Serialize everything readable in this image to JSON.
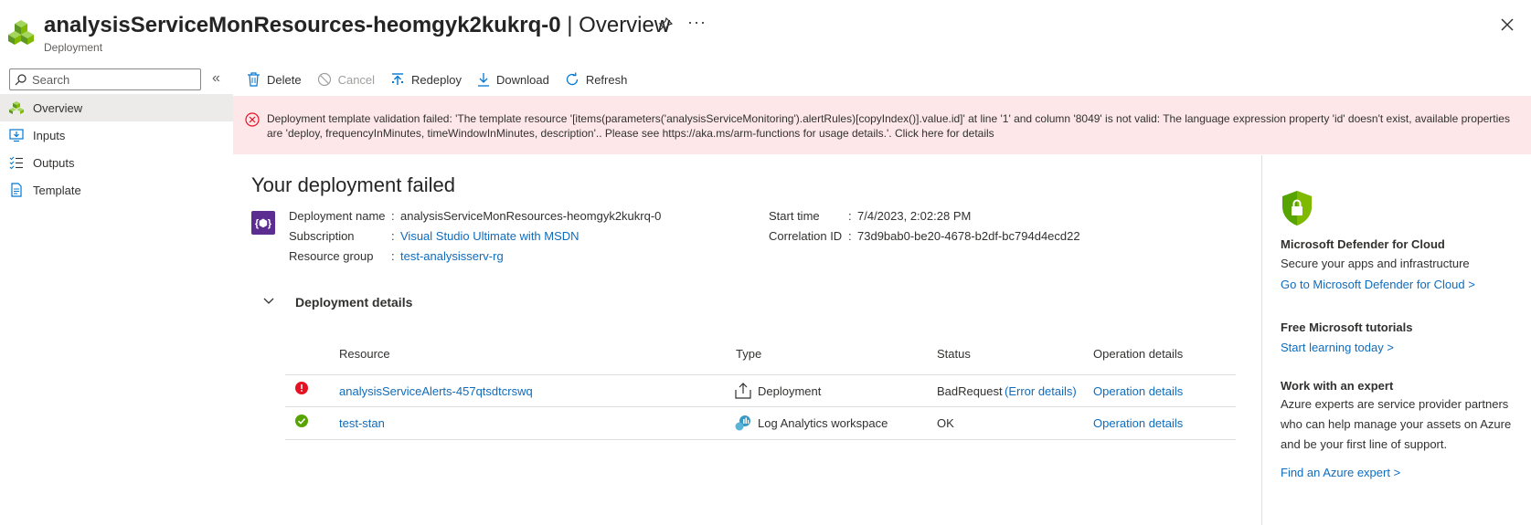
{
  "header": {
    "resource_name": "analysisServiceMonResources-heomgyk2kukrq-0",
    "separator": " | ",
    "page": "Overview",
    "subtitle": "Deployment",
    "more": "···"
  },
  "sidebar": {
    "search_placeholder": "Search",
    "collapse": "«",
    "items": [
      {
        "label": "Overview",
        "icon": "overview-cubes-icon",
        "active": true
      },
      {
        "label": "Inputs",
        "icon": "inputs-icon"
      },
      {
        "label": "Outputs",
        "icon": "outputs-icon"
      },
      {
        "label": "Template",
        "icon": "template-icon"
      }
    ]
  },
  "toolbar": {
    "delete": "Delete",
    "cancel": "Cancel",
    "redeploy": "Redeploy",
    "download": "Download",
    "refresh": "Refresh"
  },
  "banner": {
    "message": "Deployment template validation failed: 'The template resource '[items(parameters('analysisServiceMonitoring').alertRules)[copyIndex()].value.id]' at line '1' and column '8049' is not valid: The language expression property 'id' doesn't exist, available properties are 'deploy, frequencyInMinutes, timeWindowInMinutes, description'.. Please see https://aka.ms/arm-functions for usage details.'. Click here for details"
  },
  "main": {
    "title": "Your deployment failed",
    "deployment_icon_text": "{⬢}",
    "deployment_name_label": "Deployment name",
    "deployment_name": "analysisServiceMonResources-heomgyk2kukrq-0",
    "subscription_label": "Subscription",
    "subscription": "Visual Studio Ultimate with MSDN",
    "resource_group_label": "Resource group",
    "resource_group": "test-analysisserv-rg",
    "start_time_label": "Start time",
    "start_time": "7/4/2023, 2:02:28 PM",
    "correlation_label": "Correlation ID",
    "correlation_id": "73d9bab0-be20-4678-b2df-bc794d4ecd22",
    "colon": ":",
    "details_title": "Deployment details"
  },
  "table": {
    "headers": [
      "Resource",
      "Type",
      "Status",
      "Operation details"
    ],
    "rows": [
      {
        "resource": "analysisServiceAlerts-457qtsdtcrswq",
        "type": "Deployment",
        "status": "BadRequest",
        "error_link": "(Error details)",
        "operation": "Operation details",
        "status_color": "#e81123"
      },
      {
        "resource": "test-stan",
        "type": "Log Analytics workspace",
        "status": "OK",
        "error_link": "",
        "operation": "Operation details",
        "status_color": "#57a300"
      }
    ]
  },
  "right_panel": {
    "defender_title": "Microsoft Defender for Cloud",
    "defender_text": "Secure your apps and infrastructure",
    "defender_link": "Go to Microsoft Defender for Cloud >",
    "tutorials_title": "Free Microsoft tutorials",
    "tutorials_link": "Start learning today >",
    "expert_title": "Work with an expert",
    "expert_text": "Azure experts are service provider partners who can help manage your assets on Azure and be your first line of support.",
    "expert_link": "Find an Azure expert >"
  },
  "colors": {
    "link": "#0f6cbd",
    "error_bg": "#fde7e9",
    "error": "#e81123",
    "success": "#57a300",
    "deployment_purple": "#5c2d91"
  }
}
